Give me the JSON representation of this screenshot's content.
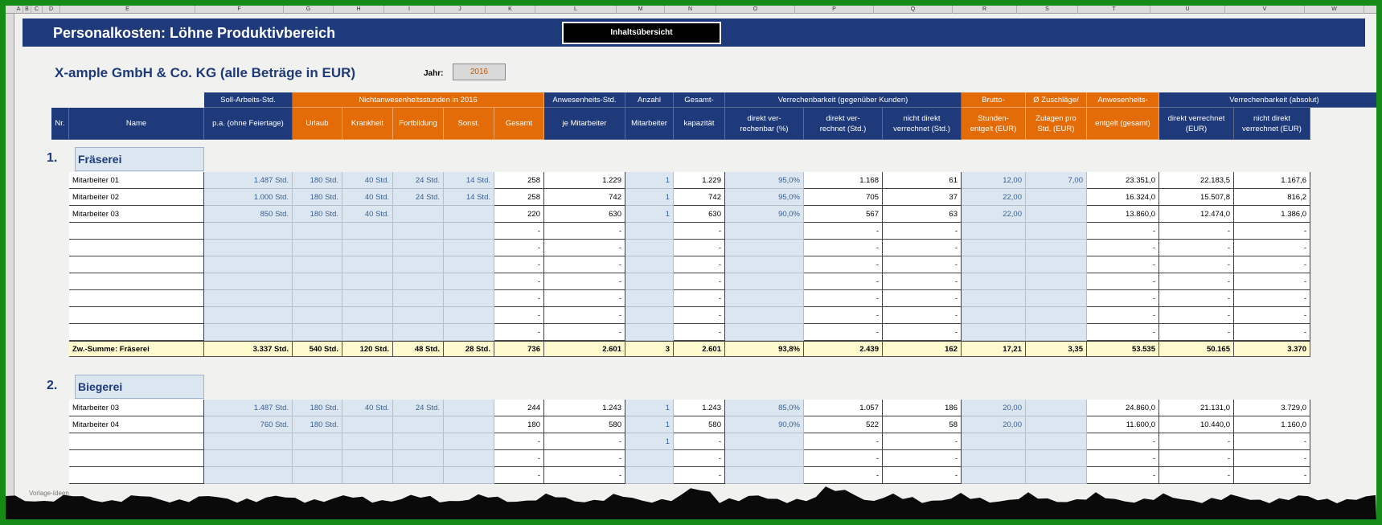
{
  "columns": [
    "A",
    "B",
    "C",
    "D",
    "E",
    "F",
    "G",
    "H",
    "I",
    "J",
    "K",
    "L",
    "M",
    "N",
    "O",
    "P",
    "Q",
    "R",
    "S",
    "T",
    "U",
    "V",
    "W"
  ],
  "title": "Personalkosten: Löhne Produktivbereich",
  "nav_button": "Inhaltsübersicht",
  "company": "X-ample GmbH & Co. KG (alle Beträge in EUR)",
  "year_label": "Jahr:",
  "year": "2016",
  "group_headers": {
    "soll": "Soll-Arbeits-Std.",
    "nicht": "Nichtanwesenheitsstunden in 2016",
    "anw": "Anwesenheits-Std.",
    "anz": "Anzahl",
    "ges": "Gesamt-",
    "verr": "Verrechenbarkeit (gegenüber Kunden)",
    "brutto": "Brutto-",
    "zu": "Ø Zuschläge/",
    "anwe": "Anwesenheits-",
    "verrabs": "Verrechenbarkeit (absolut)"
  },
  "headers": [
    "Nr.",
    "Name",
    "p.a. (ohne Feiertage)",
    "Urlaub",
    "Krankheit",
    "Fortbildung",
    "Sonst.",
    "Gesamt",
    "je Mitarbeiter",
    "Mitarbeiter",
    "kapazität",
    "direkt ver-\nrechenbar (%)",
    "direkt ver-\nrechnet (Std.)",
    "nicht direkt\nverrechnet (Std.)",
    "Stunden-\nentgelt (EUR)",
    "Zulagen pro\nStd. (EUR)",
    "entgelt (gesamt)",
    "direkt verrechnet\n(EUR)",
    "nicht direkt\nverrechnet (EUR)"
  ],
  "sections": [
    {
      "num": "1.",
      "name": "Fräserei",
      "rows": [
        [
          "Mitarbeiter 01",
          "1.487 Std.",
          "180 Std.",
          "40 Std.",
          "24 Std.",
          "14 Std.",
          "258",
          "1.229",
          "1",
          "1.229",
          "95,0%",
          "1.168",
          "61",
          "12,00",
          "7,00",
          "23.351,0",
          "22.183,5",
          "1.167,6"
        ],
        [
          "Mitarbeiter 02",
          "1.000 Std.",
          "180 Std.",
          "40 Std.",
          "24 Std.",
          "14 Std.",
          "258",
          "742",
          "1",
          "742",
          "95,0%",
          "705",
          "37",
          "22,00",
          "",
          "16.324,0",
          "15.507,8",
          "816,2"
        ],
        [
          "Mitarbeiter 03",
          "850 Std.",
          "180 Std.",
          "40 Std.",
          "",
          "",
          "220",
          "630",
          "1",
          "630",
          "90,0%",
          "567",
          "63",
          "22,00",
          "",
          "13.860,0",
          "12.474,0",
          "1.386,0"
        ],
        [
          "",
          "",
          "",
          "",
          "",
          "",
          "-",
          "-",
          "",
          "-",
          "",
          "-",
          "-",
          "",
          "",
          "-",
          "-",
          "-"
        ],
        [
          "",
          "",
          "",
          "",
          "",
          "",
          "-",
          "-",
          "",
          "-",
          "",
          "-",
          "-",
          "",
          "",
          "-",
          "-",
          "-"
        ],
        [
          "",
          "",
          "",
          "",
          "",
          "",
          "-",
          "-",
          "",
          "-",
          "",
          "-",
          "-",
          "",
          "",
          "-",
          "-",
          "-"
        ],
        [
          "",
          "",
          "",
          "",
          "",
          "",
          "-",
          "-",
          "",
          "-",
          "",
          "-",
          "-",
          "",
          "",
          "-",
          "-",
          "-"
        ],
        [
          "",
          "",
          "",
          "",
          "",
          "",
          "-",
          "-",
          "",
          "-",
          "",
          "-",
          "-",
          "",
          "",
          "-",
          "-",
          "-"
        ],
        [
          "",
          "",
          "",
          "",
          "",
          "",
          "-",
          "-",
          "",
          "-",
          "",
          "-",
          "-",
          "",
          "",
          "-",
          "-",
          "-"
        ],
        [
          "",
          "",
          "",
          "",
          "",
          "",
          "-",
          "-",
          "",
          "-",
          "",
          "-",
          "-",
          "",
          "",
          "-",
          "-",
          "-"
        ]
      ],
      "sum": [
        "Zw.-Summe: Fräserei",
        "3.337 Std.",
        "540 Std.",
        "120 Std.",
        "48 Std.",
        "28 Std.",
        "736",
        "2.601",
        "3",
        "2.601",
        "93,8%",
        "2.439",
        "162",
        "17,21",
        "3,35",
        "53.535",
        "50.165",
        "3.370"
      ]
    },
    {
      "num": "2.",
      "name": "Biegerei",
      "rows": [
        [
          "Mitarbeiter 03",
          "1.487 Std.",
          "180 Std.",
          "40 Std.",
          "24 Std.",
          "",
          "244",
          "1.243",
          "1",
          "1.243",
          "85,0%",
          "1.057",
          "186",
          "20,00",
          "",
          "24.860,0",
          "21.131,0",
          "3.729,0"
        ],
        [
          "Mitarbeiter 04",
          "760 Std.",
          "180 Std.",
          "",
          "",
          "",
          "180",
          "580",
          "1",
          "580",
          "90,0%",
          "522",
          "58",
          "20,00",
          "",
          "11.600,0",
          "10.440,0",
          "1.160,0"
        ],
        [
          "",
          "",
          "",
          "",
          "",
          "",
          "-",
          "-",
          "1",
          "-",
          "",
          "-",
          "-",
          "",
          "",
          "-",
          "-",
          "-"
        ],
        [
          "",
          "",
          "",
          "",
          "",
          "",
          "-",
          "-",
          "",
          "-",
          "",
          "-",
          "-",
          "",
          "",
          "-",
          "-",
          "-"
        ],
        [
          "",
          "",
          "",
          "",
          "",
          "",
          "-",
          "-",
          "",
          "-",
          "",
          "-",
          "-",
          "",
          "",
          "-",
          "-",
          "-"
        ]
      ]
    }
  ],
  "footnote": "Vorlage-Ideen"
}
